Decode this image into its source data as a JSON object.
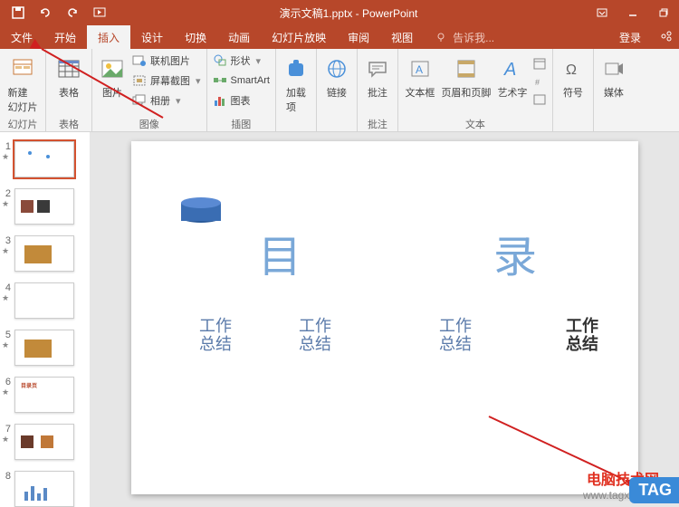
{
  "titlebar": {
    "title": "演示文稿1.pptx - PowerPoint"
  },
  "menubar": {
    "tabs": [
      {
        "label": "文件"
      },
      {
        "label": "开始"
      },
      {
        "label": "插入"
      },
      {
        "label": "设计"
      },
      {
        "label": "切换"
      },
      {
        "label": "动画"
      },
      {
        "label": "幻灯片放映"
      },
      {
        "label": "审阅"
      },
      {
        "label": "视图"
      }
    ],
    "tellme": "告诉我...",
    "login": "登录"
  },
  "ribbon": {
    "new_slide": "新建\n幻灯片",
    "g_slides": "幻灯片",
    "table": "表格",
    "g_tables": "表格",
    "pictures": "图片",
    "online_pic": "联机图片",
    "screenshot": "屏幕截图",
    "album": "相册",
    "g_images": "图像",
    "shapes": "形状",
    "smartart": "SmartArt",
    "chart": "图表",
    "g_illus": "插图",
    "addin": "加载\n项",
    "link": "链接",
    "comment": "批注",
    "g_comments": "批注",
    "textbox": "文本框",
    "headerfooter": "页眉和页脚",
    "wordart": "艺术字",
    "g_text": "文本",
    "symbol": "符号",
    "media": "媒体"
  },
  "thumbs": {
    "numbers": [
      "1",
      "2",
      "3",
      "4",
      "5",
      "6",
      "7",
      "8"
    ],
    "th6_title": "目录页"
  },
  "slide": {
    "char_mu": "目",
    "char_lu": "录",
    "text1": "工作\n总结",
    "text2": "工作\n总结",
    "text3": "工作\n总结",
    "text4": "工作\n总结"
  },
  "watermark": {
    "line1": "电脑技术网",
    "line2": "www.tagxp.com",
    "tag": "TAG"
  }
}
